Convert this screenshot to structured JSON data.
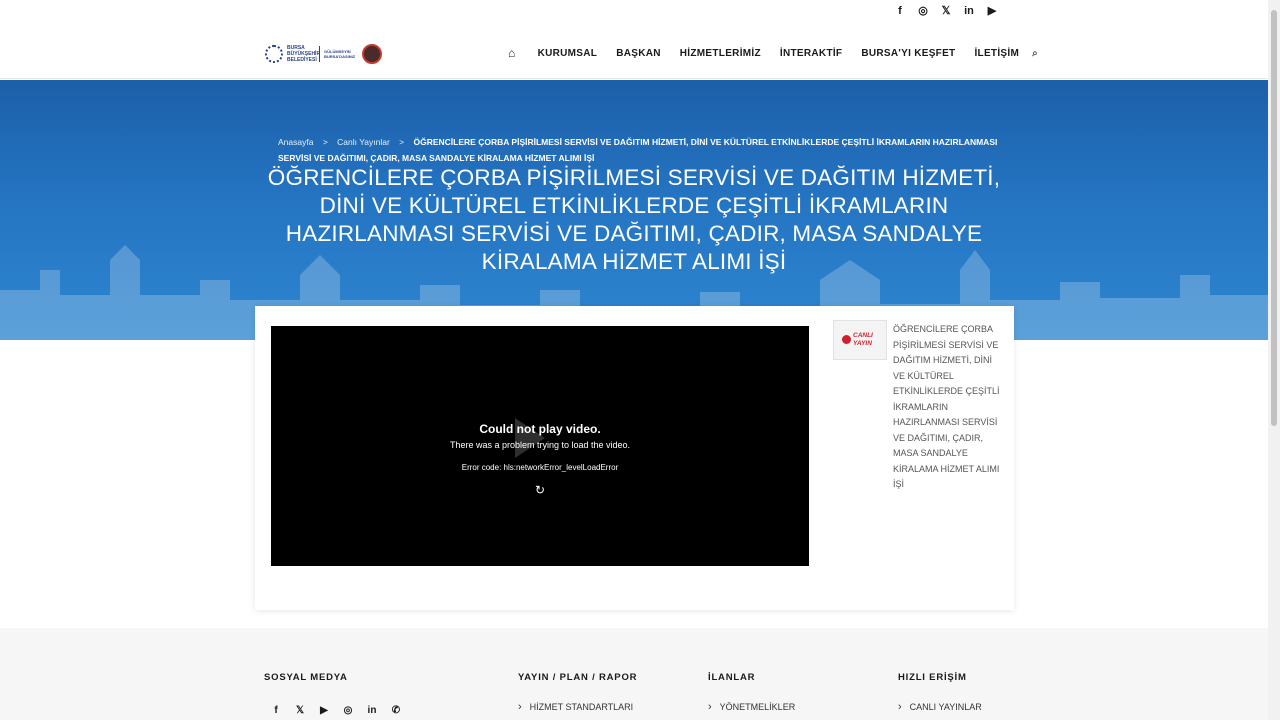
{
  "social_top": [
    {
      "icon": "facebook-icon",
      "glyph": "f"
    },
    {
      "icon": "instagram-icon",
      "glyph": "◎"
    },
    {
      "icon": "x-icon",
      "glyph": "𝕏"
    },
    {
      "icon": "linkedin-icon",
      "glyph": "in"
    },
    {
      "icon": "youtube-icon",
      "glyph": "▶"
    }
  ],
  "logo": {
    "line1": "BURSA",
    "line2": "BÜYÜKŞEHİR BELEDİYESİ",
    "slogan": "GÜLÜMSEYİN BURSA'DASINIZ"
  },
  "nav": {
    "home_glyph": "⌂",
    "items": [
      "KURUMSAL",
      "BAŞKAN",
      "HİZMETLERİMİZ",
      "İNTERAKTİF",
      "BURSA'YI KEŞFET",
      "İLETİŞİM"
    ],
    "search_glyph": "⌕"
  },
  "breadcrumb": {
    "home": "Anasayfa",
    "sep": ">",
    "parent": "Canlı Yayınlar",
    "current": "ÖĞRENCİLERE ÇORBA PİŞİRİLMESİ SERVİSİ VE DAĞITIM HİZMETİ, DİNİ VE KÜLTÜREL ETKİNLİKLERDE ÇEŞİTLİ İKRAMLARIN HAZIRLANMASI SERVİSİ VE DAĞITIMI, ÇADIR, MASA SANDALYE KİRALAMA HİZMET ALIMI İŞİ"
  },
  "page_title": "ÖĞRENCİLERE ÇORBA PİŞİRİLMESİ SERVİSİ VE DAĞITIM HİZMETİ, DİNİ VE KÜLTÜREL ETKİNLİKLERDE ÇEŞİTLİ İKRAMLARIN HAZIRLANMASI SERVİSİ VE DAĞITIMI, ÇADIR, MASA SANDALYE KİRALAMA HİZMET ALIMI İŞİ",
  "video": {
    "error_title": "Could not play video.",
    "error_message": "There was a problem trying to load the video.",
    "error_code": "Error code: hls:networkError_levelLoadError",
    "reload_glyph": "↻"
  },
  "sidebar": {
    "thumb_text": "CANLI YAYIN",
    "title": "ÖĞRENCİLERE ÇORBA PİŞİRİLMESİ SERVİSİ VE DAĞITIM HİZMETİ, DİNİ VE KÜLTÜREL ETKİNLİKLERDE ÇEŞİTLİ İKRAMLARIN HAZIRLANMASI SERVİSİ VE DAĞITIMI, ÇADIR, MASA SANDALYE KİRALAMA HİZMET ALIMI İŞİ"
  },
  "footer": {
    "social_head": "SOSYAL MEDYA",
    "social": [
      {
        "icon": "facebook-icon",
        "glyph": "f"
      },
      {
        "icon": "x-icon",
        "glyph": "𝕏"
      },
      {
        "icon": "youtube-icon",
        "glyph": "▶"
      },
      {
        "icon": "instagram-icon",
        "glyph": "◎"
      },
      {
        "icon": "linkedin-icon",
        "glyph": "in"
      },
      {
        "icon": "whatsapp-icon",
        "glyph": "✆"
      }
    ],
    "col2_head": "YAYIN / PLAN / RAPOR",
    "col2_link": "HİZMET STANDARTLARI",
    "col3_head": "İLANLAR",
    "col3_link": "YÖNETMELİKLER",
    "col4_head": "HIZLI ERİŞİM",
    "col4_link": "CANLI YAYINLAR"
  },
  "colors": {
    "hero": "#2474c2",
    "live_red": "#d01f2e"
  }
}
